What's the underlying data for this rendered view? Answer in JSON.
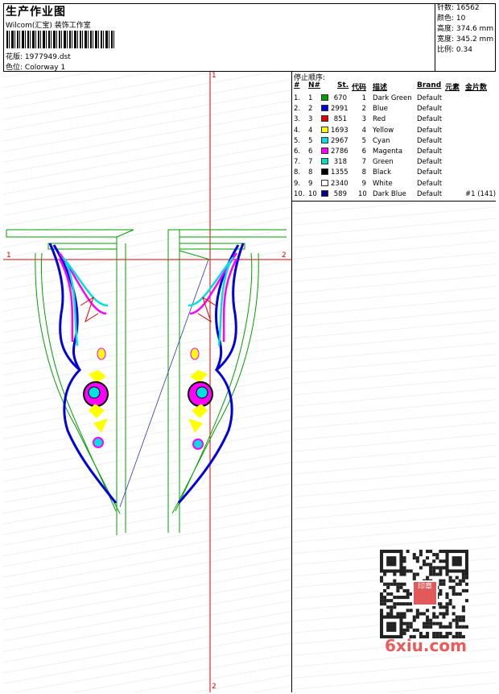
{
  "header": {
    "title": "生产作业图",
    "company": "Wilcom(汇宝) 装饰工作室",
    "design_label": "花版:",
    "design_value": "1977949.dst",
    "colorway_label": "色位:",
    "colorway_value": "Colorway 1"
  },
  "stats": [
    {
      "label": "针数:",
      "value": "16562"
    },
    {
      "label": "颜色:",
      "value": "10"
    },
    {
      "label": "高度:",
      "value": "374.6 mm"
    },
    {
      "label": "宽度:",
      "value": "345.2 mm"
    },
    {
      "label": "比例:",
      "value": "0.34"
    }
  ],
  "stop_sequence": {
    "title": "停止顺序:",
    "columns": [
      "#",
      "N#",
      "St.",
      "代码",
      "描述",
      "Brand",
      "元素",
      "金片数"
    ],
    "rows": [
      {
        "num": "1.",
        "n": "1",
        "color": "#00a000",
        "st": "670",
        "code": "1",
        "desc": "Dark Green",
        "brand": "Default",
        "extra": ""
      },
      {
        "num": "2.",
        "n": "2",
        "color": "#0000e0",
        "st": "2991",
        "code": "2",
        "desc": "Blue",
        "brand": "Default",
        "extra": ""
      },
      {
        "num": "3.",
        "n": "3",
        "color": "#e00000",
        "st": "851",
        "code": "3",
        "desc": "Red",
        "brand": "Default",
        "extra": ""
      },
      {
        "num": "4.",
        "n": "4",
        "color": "#ffff00",
        "st": "1693",
        "code": "4",
        "desc": "Yellow",
        "brand": "Default",
        "extra": ""
      },
      {
        "num": "5.",
        "n": "5",
        "color": "#00e0e0",
        "st": "2967",
        "code": "5",
        "desc": "Cyan",
        "brand": "Default",
        "extra": ""
      },
      {
        "num": "6.",
        "n": "6",
        "color": "#ff00ff",
        "st": "2786",
        "code": "6",
        "desc": "Magenta",
        "brand": "Default",
        "extra": ""
      },
      {
        "num": "7.",
        "n": "7",
        "color": "#00e0c0",
        "st": "318",
        "code": "7",
        "desc": "Green",
        "brand": "Default",
        "extra": ""
      },
      {
        "num": "8.",
        "n": "8",
        "color": "#000000",
        "st": "1355",
        "code": "8",
        "desc": "Black",
        "brand": "Default",
        "extra": ""
      },
      {
        "num": "9.",
        "n": "9",
        "color": "#ffffff",
        "st": "2340",
        "code": "9",
        "desc": "White",
        "brand": "Default",
        "extra": ""
      },
      {
        "num": "10.",
        "n": "10",
        "color": "#000090",
        "st": "589",
        "code": "10",
        "desc": "Dark Blue",
        "brand": "Default",
        "extra": "#1 (141)"
      }
    ]
  },
  "axes": {
    "top": "1",
    "bottom": "2",
    "left": "1",
    "right": "2"
  },
  "watermark": {
    "text": "6xiu.com",
    "stamp": "印章"
  }
}
